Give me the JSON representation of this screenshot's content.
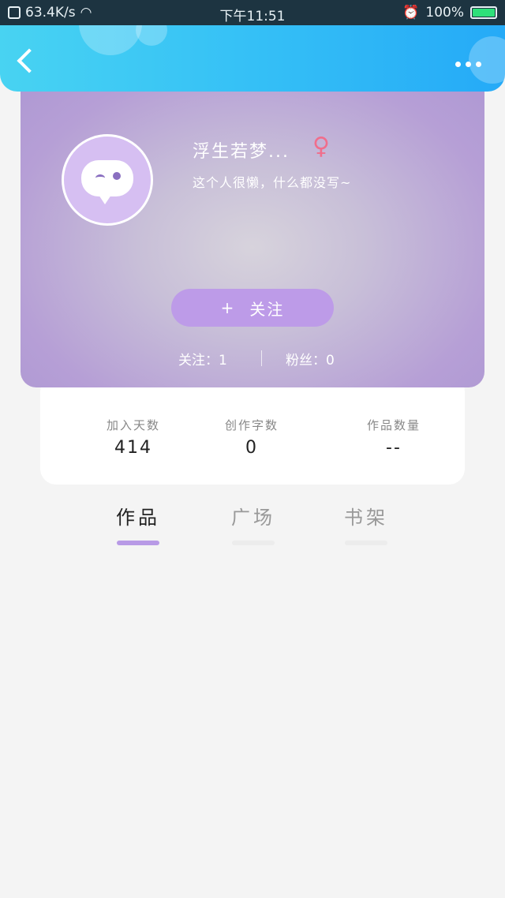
{
  "status_bar": {
    "speed": "63.4K/s",
    "time": "下午11:51",
    "battery": "100%"
  },
  "header": {
    "back_icon": "chevron-left-icon",
    "more_icon": "more-dots-icon"
  },
  "profile": {
    "username": "浮生若梦...",
    "gender_icon": "♀",
    "bio": "这个人很懒，什么都没写~",
    "follow_button": {
      "plus": "+",
      "label": "关注"
    },
    "following": "关注：1",
    "fans": "粉丝：0"
  },
  "stats": [
    {
      "label": "加入天数",
      "value": "414"
    },
    {
      "label": "创作字数",
      "value": "0"
    },
    {
      "label": "作品数量",
      "value": "--"
    }
  ],
  "tabs": [
    {
      "label": "作品",
      "active": true
    },
    {
      "label": "广场",
      "active": false
    },
    {
      "label": "书架",
      "active": false
    }
  ],
  "colors": {
    "header_start": "#48d3f2",
    "header_end": "#25aaf7",
    "accent": "#b89ae6",
    "gender": "#f06e8c"
  }
}
